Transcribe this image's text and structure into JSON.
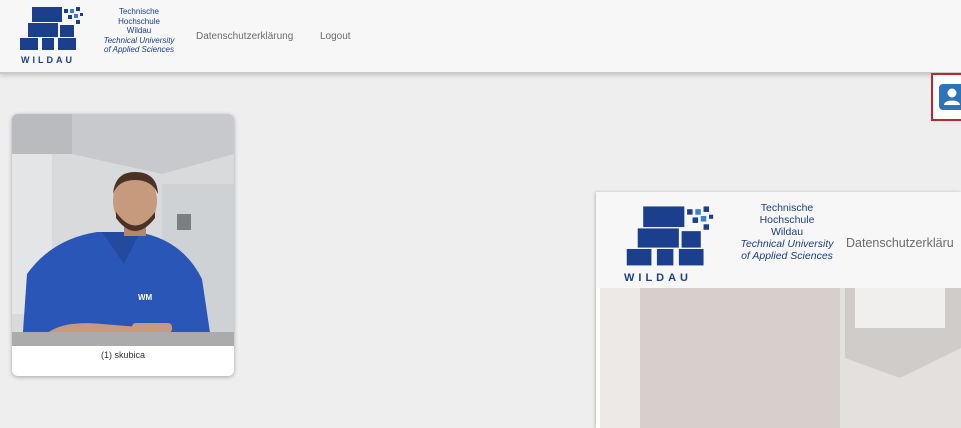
{
  "logo": {
    "line1": "Technische",
    "line2": "Hochschule",
    "line3": "Wildau",
    "line4": "Technical University",
    "line5": "of Applied Sciences",
    "mark": "WILDAU"
  },
  "nav": {
    "privacy_label": "Datenschutzerklärung",
    "logout_label": "Logout"
  },
  "user_button": {
    "icon": "user-icon",
    "accent": "#2c73b9",
    "highlight": "#c0262d"
  },
  "participant": {
    "caption": "(1) skubica"
  },
  "overlay_window": {
    "logo": {
      "line1": "Technische",
      "line2": "Hochschule",
      "line3": "Wildau",
      "line4": "Technical University",
      "line5": "of Applied Sciences",
      "mark": "WILDAU"
    },
    "nav_partial": "Datenschutzerkläru"
  }
}
